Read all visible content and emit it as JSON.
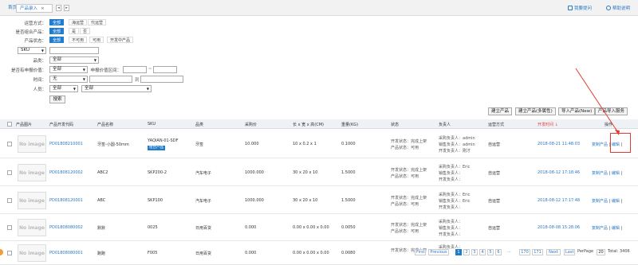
{
  "tabs": {
    "home": "首页",
    "active": "产品录入",
    "close": "×",
    "nav_prev": "◂",
    "nav_next": "▸"
  },
  "top_right": {
    "report": "我要提问",
    "help": "帮助说明"
  },
  "filters": {
    "shipping_label": "运营方式：",
    "shipping_opts": [
      "全部",
      "海运营",
      "代运营"
    ],
    "combo_label": "是否组合产品：",
    "combo_opts": [
      "全部",
      "是",
      "否"
    ],
    "status_label": "产品状态：",
    "status_opts": [
      "全部",
      "不可用",
      "可用",
      "开发中产品"
    ],
    "sku_select": "SKU",
    "category_label": "品类：",
    "category_value": "全部",
    "date_label": "是否有申报价值：",
    "date_value": "全部",
    "range_label": "申报价值区间：",
    "range_sep": "~",
    "time_label": "时间：",
    "time_value": "无",
    "to_label": "到",
    "person_label": "人员：",
    "person_value": "全部",
    "person_value2": "全部",
    "search_btn": "搜索"
  },
  "actions": [
    "建立产品",
    "建立产品(多属性)",
    "导入产品(New)",
    "产品导入服务"
  ],
  "columns": {
    "img": "产品图片",
    "code": "产品开发代码",
    "name": "产品名称",
    "sku": "SKU",
    "category": "品类",
    "price": "采购价",
    "size": "长 x 宽 x 高(CM)",
    "weight": "重量(KG)",
    "state": "状态",
    "owner": "负责人",
    "mode": "运营方式",
    "dev_time": "开发时间 ↓",
    "op": "操作"
  },
  "no_image": "No image",
  "rows": [
    {
      "code": "PD01808210001",
      "name": "牙签-小圆-50mm",
      "sku": "YAQIAN-01-SDF",
      "badge": "组合产品",
      "category": "牙签",
      "price": "10.000",
      "size": "10 x 0.2 x 1",
      "weight": "0.1000",
      "state1": "开发状态：完成上架",
      "state2": "产品状态：可用",
      "o1": "采购负责人：admin",
      "o2": "销售负责人：admin",
      "o3": "开发负责人：刚才",
      "mode": "自运营",
      "time": "2018-08-21 11:48:03",
      "copy": "复制产品",
      "edit": "编辑"
    },
    {
      "code": "PD01808120002",
      "name": "ABC2",
      "sku": "SKP200-2",
      "badge": "",
      "category": "汽车电子",
      "price": "1000.000",
      "size": "30 x 20 x 10",
      "weight": "1.5000",
      "state1": "开发状态：完成上架",
      "state2": "产品状态：可用",
      "o1": "采购负责人：Eric",
      "o2": "销售负责人：",
      "o3": "开发负责人：",
      "mode": "自运营",
      "time": "2018-08-12 17:18:46",
      "copy": "复制产品",
      "edit": "编辑"
    },
    {
      "code": "PD01808120001",
      "name": "ABC",
      "sku": "SKP100",
      "badge": "",
      "category": "汽车电子",
      "price": "1000.000",
      "size": "30 x 20 x 10",
      "weight": "1.5000",
      "state1": "开发状态：完成上架",
      "state2": "产品状态：可用",
      "o1": "采购负责人：Eric",
      "o2": "销售负责人：Eric",
      "o3": "开发负责人：",
      "mode": "自运营",
      "time": "2018-08-12 17:17:48",
      "copy": "复制产品",
      "edit": "编辑"
    },
    {
      "code": "PD01808080002",
      "name": "默默",
      "sku": "0025",
      "badge": "",
      "category": "日用百货",
      "price": "0.000",
      "size": "0.00 x 0.00 x 0.00",
      "weight": "0.0050",
      "state1": "开发状态：完成上架",
      "state2": "产品状态：可用",
      "o1": "采购负责人：",
      "o2": "销售负责人：",
      "o3": "开发负责人：",
      "mode": "自运营",
      "time": "2018-08-08 15:28:06",
      "copy": "复制产品",
      "edit": "编辑"
    },
    {
      "code": "PD01808080001",
      "name": "跑跑",
      "sku": "F005",
      "badge": "",
      "category": "日用百货",
      "price": "0.000",
      "size": "0.00 x 0.00 x 0.00",
      "weight": "0.0080",
      "state1": "开发状态：完成上架",
      "state2": "",
      "o1": "采购负责人：",
      "o2": "",
      "o3": "",
      "mode": "",
      "time": "",
      "copy": "",
      "edit": ""
    }
  ],
  "pager": {
    "first": "First",
    "prev": "Previous",
    "pages": [
      "1",
      "2",
      "3",
      "4",
      "5",
      "6"
    ],
    "dots": "...",
    "p170": "170",
    "p171": "171",
    "next": "Next",
    "last": "Last",
    "per_page_label": "PerPage",
    "per_page": "20",
    "total": "Total: 3406"
  },
  "colors": {
    "accent": "#1f7ccf",
    "link": "#2a78c4",
    "red": "#e53935"
  }
}
